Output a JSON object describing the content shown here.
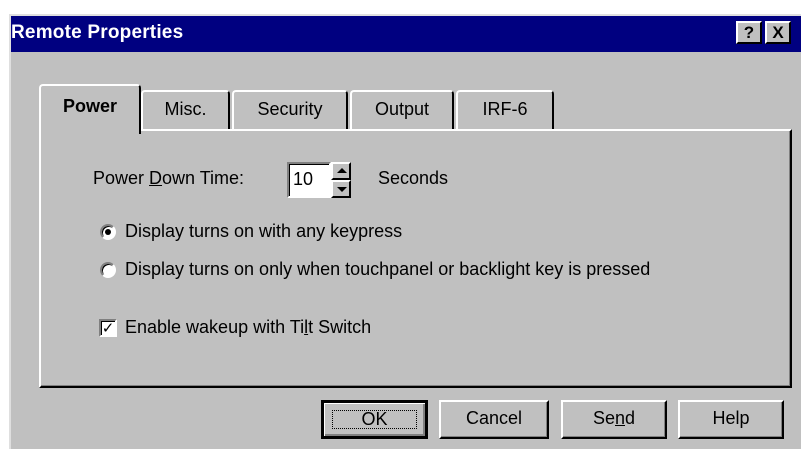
{
  "window": {
    "title": "Remote Properties",
    "help_button": "?",
    "close_button": "X",
    "title_bar_color": "#000080",
    "face_color": "#c0c0c0"
  },
  "tabs": [
    {
      "label": "Power",
      "active": true
    },
    {
      "label": "Misc.",
      "active": false
    },
    {
      "label": "Security",
      "active": false
    },
    {
      "label": "Output",
      "active": false
    },
    {
      "label": "IRF-6",
      "active": false
    }
  ],
  "power": {
    "power_down_label_pre": "Power ",
    "power_down_label_accel": "D",
    "power_down_label_post": "own Time:",
    "power_down_value": "10",
    "seconds_label": "Seconds",
    "radio_options": [
      {
        "label": "Display turns on with any keypress",
        "selected": true
      },
      {
        "label": "Display turns on only when touchpanel or backlight key is pressed",
        "selected": false
      }
    ],
    "tilt_checkbox": {
      "checked": true,
      "label_pre": "Enable wakeup with Ti",
      "label_accel": "l",
      "label_post": "t Switch"
    }
  },
  "buttons": {
    "ok": "OK",
    "cancel": "Cancel",
    "send_pre": "Se",
    "send_accel": "n",
    "send_post": "d",
    "help": "Help"
  }
}
